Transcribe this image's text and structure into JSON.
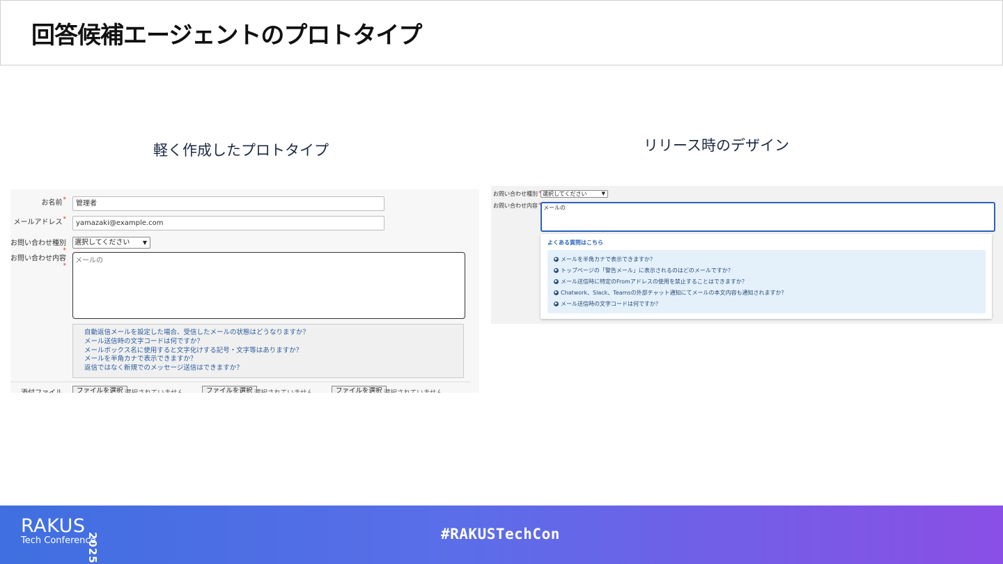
{
  "slide": {
    "title": "回答候補エージェントのプロトタイプ",
    "left_heading": "軽く作成したプロトタイプ",
    "right_heading": "リリース時のデザイン"
  },
  "prototype": {
    "name_label": "お名前",
    "name_value": "管理者",
    "email_label": "メールアドレス",
    "email_value": "yamazaki@example.com",
    "type_label": "お問い合わせ種別",
    "type_selected": "選択してください",
    "content_label": "お問い合わせ内容",
    "content_value": "メールの",
    "required_mark": "*",
    "faq": [
      "自動返信メールを設定した場合、受信したメールの状態はどうなりますか？",
      "メール送信時の文字コードは何ですか？",
      "メールボックス名に使用すると文字化けする記号・文字等はありますか？",
      "メールを半角カナで表示できますか？",
      "返信ではなく新規でのメッセージ送信はできますか？"
    ],
    "attach_label": "添付ファイル",
    "file_button_label": "ファイルを選択",
    "file_status": "選択されていません"
  },
  "release": {
    "type_label": "お問い合わせ種別",
    "type_selected": "選択してください",
    "content_label": "お問い合わせ内容",
    "content_value": "メールの",
    "required_mark": "*",
    "faq_title": "よくある質問はこちら",
    "faq": [
      "メールを半角カナで表示できますか？",
      "トップページの「警告メール」に表示されるのはどのメールですか？",
      "メール送信時に特定のFromアドレスの使用を禁止することはできますか？",
      "Chatwork、Slack、Teamsの外部チャット通知にてメールの本文内容も通知されますか？",
      "メール送信時の文字コードは何ですか？"
    ]
  },
  "footer": {
    "logo_main": "RAKUS",
    "logo_sub": "Tech Conference",
    "logo_year": "2025",
    "hashtag": "#RAKUSTechCon"
  },
  "colors": {
    "accent_blue": "#2a63b8",
    "link_blue": "#2b5b9f",
    "footer_gradient_start": "#3f6fe0",
    "footer_gradient_end": "#8a4fe6"
  }
}
